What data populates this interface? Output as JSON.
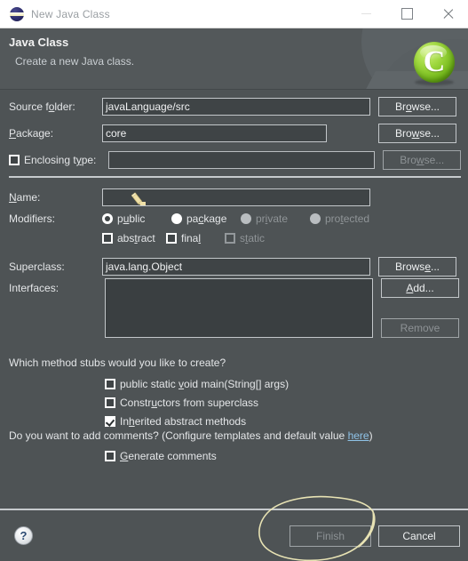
{
  "window": {
    "title": "New Java Class",
    "icon": "eclipse-icon",
    "controls": {
      "minimize": "minimize-icon",
      "maximize": "maximize-icon",
      "close": "close-icon"
    }
  },
  "banner": {
    "title": "Java Class",
    "subtitle": "Create a new Java class.",
    "logo_letter": "C",
    "logo_icon": "java-class-wizard-icon"
  },
  "colors": {
    "dialog_bg": "#4e5355",
    "banner_bg": "#53585a",
    "field_bg": "#3f4446",
    "field_border": "#c3c7ca",
    "text": "#e4e6e8",
    "text_disabled": "#8f9497",
    "titlebar_bg": "#ffffff",
    "titlebar_text": "#999ea2",
    "link": "#8fc3e8",
    "annotation": "#e8e3b4",
    "logo_green": "#9fd83f"
  },
  "form": {
    "source_folder": {
      "label_pre": "Source f",
      "label_mn": "o",
      "label_post": "lder:",
      "value": "javaLanguage/src",
      "browse": {
        "pre": "Br",
        "mn": "o",
        "post": "wse..."
      }
    },
    "package": {
      "label_pre": "",
      "label_mn": "P",
      "label_post": "ackage:",
      "value": "core",
      "browse": {
        "pre": "Bro",
        "mn": "w",
        "post": "se..."
      }
    },
    "enclosing_type": {
      "label_pre": "Enclosing t",
      "label_mn": "y",
      "label_post": "pe:",
      "checked": false,
      "value": "",
      "browse": {
        "pre": "Bro",
        "mn": "w",
        "post": "se..."
      },
      "browse_disabled": true
    },
    "name": {
      "label_pre": "",
      "label_mn": "N",
      "label_post": "ame:",
      "value": "",
      "annotation_icon": "pencil-cursor-icon"
    },
    "modifiers": {
      "label": "Modifiers:",
      "radios": [
        {
          "pre": "p",
          "mn": "u",
          "post": "blic",
          "selected": true,
          "disabled": false
        },
        {
          "pre": "pa",
          "mn": "c",
          "post": "kage",
          "selected": false,
          "disabled": false
        },
        {
          "pre": "pr",
          "mn": "i",
          "post": "vate",
          "selected": false,
          "disabled": true
        },
        {
          "pre": "pro",
          "mn": "t",
          "post": "ected",
          "selected": false,
          "disabled": true
        }
      ],
      "checkboxes": [
        {
          "pre": "abs",
          "mn": "t",
          "post": "ract",
          "checked": false,
          "disabled": false
        },
        {
          "pre": "fina",
          "mn": "l",
          "post": "",
          "checked": false,
          "disabled": false
        },
        {
          "pre": "s",
          "mn": "t",
          "post": "atic",
          "checked": false,
          "disabled": true
        }
      ]
    },
    "superclass": {
      "label_pre": "Superclass:",
      "label_mn": "",
      "label_post": "",
      "value": "java.lang.Object",
      "browse": {
        "pre": "Brows",
        "mn": "e",
        "post": "..."
      }
    },
    "interfaces": {
      "label": "Interfaces:",
      "items": [],
      "add": {
        "pre": "",
        "mn": "A",
        "post": "dd..."
      },
      "remove": {
        "pre": "",
        "mn": "",
        "post": "Remove"
      },
      "remove_disabled": true
    },
    "stubs": {
      "question": "Which method stubs would you like to create?",
      "options": [
        {
          "pre": "public static ",
          "mn": "v",
          "post": "oid main(String[] args)",
          "checked": false
        },
        {
          "pre": "Constr",
          "mn": "u",
          "post": "ctors from superclass",
          "checked": false
        },
        {
          "pre": "In",
          "mn": "h",
          "post": "erited abstract methods",
          "checked": true
        }
      ]
    },
    "comments": {
      "question_pre": "Do you want to add comments? (Configure templates and default value ",
      "link": "here",
      "question_post": ")",
      "option": {
        "pre": "",
        "mn": "G",
        "post": "enerate comments",
        "checked": false
      }
    }
  },
  "footer": {
    "help": "?",
    "finish": "Finish",
    "finish_disabled": true,
    "cancel": "Cancel"
  }
}
